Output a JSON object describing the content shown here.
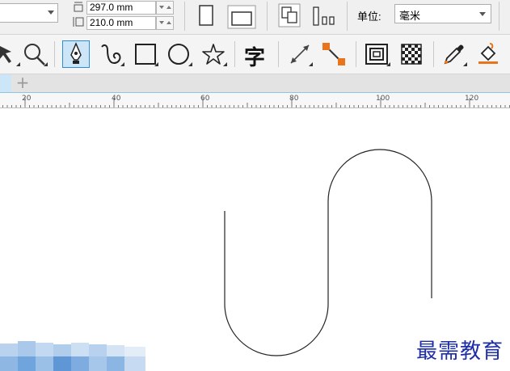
{
  "property_bar": {
    "page_height_value": "297.0 mm",
    "page_width_value": "210.0 mm",
    "units_label": "单位:",
    "units_value": "毫米"
  },
  "toolbox": {
    "tools": [
      "shape-tool",
      "zoom-tool",
      "pen-tool",
      "bspline-tool",
      "rectangle-tool",
      "ellipse-tool",
      "polygon-tool",
      "text-tool",
      "parallel-dimension-tool",
      "connector-tool",
      "contour-tool",
      "transparency-tool",
      "eyedropper-tool",
      "fill-tool"
    ],
    "text_tool_glyph": "字",
    "active_tool": "pen-tool"
  },
  "tabs": {
    "add_label": "+"
  },
  "ruler": {
    "unit": "mm",
    "ticks": [
      "20",
      "40",
      "60",
      "80",
      "100",
      "120"
    ]
  },
  "watermark": "最需教育",
  "colors": {
    "accent": "#2e8bd6",
    "active_bg": "#cde6f7",
    "watermark": "#1e2ea6",
    "connector_orange": "#e8741c"
  }
}
